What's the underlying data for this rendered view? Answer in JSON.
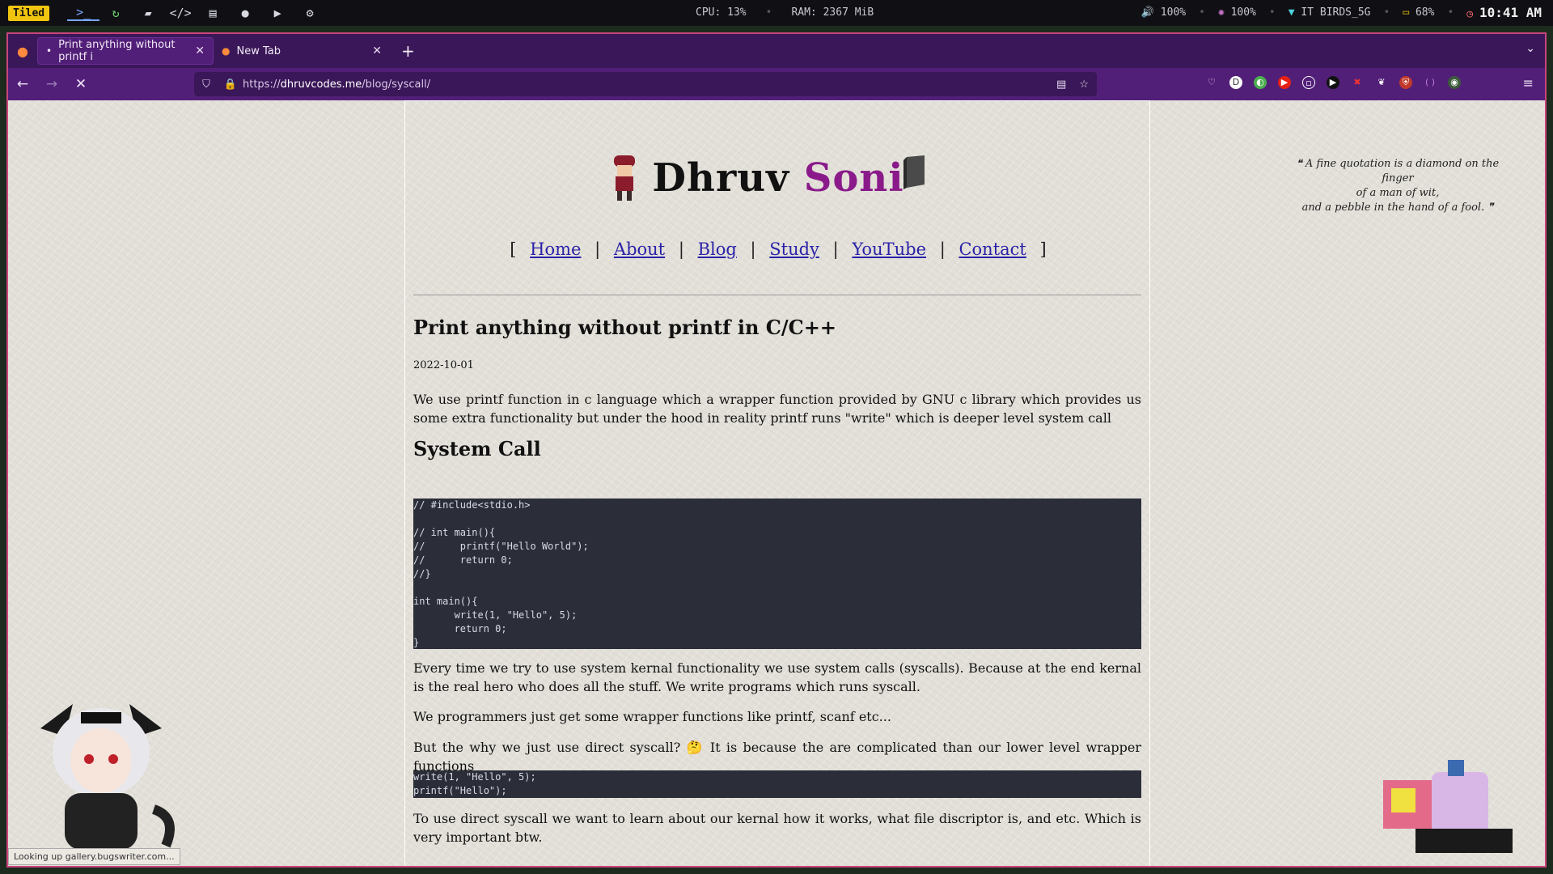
{
  "sysbar": {
    "tiled_label": "Tiled",
    "cpu": "CPU: 13%",
    "ram": "RAM: 2367 MiB",
    "volume": "100%",
    "brightness": "100%",
    "wifi": "IT BIRDS_5G",
    "battery": "68%",
    "clock": "10:41 AM"
  },
  "browser": {
    "tabs": [
      {
        "title": "Print anything without printf i"
      },
      {
        "title": "New Tab"
      }
    ],
    "url": {
      "scheme": "https://",
      "host": "dhruvcodes.me",
      "path": "/blog/syscall/"
    },
    "status_tip": "Looking up gallery.bugswriter.com..."
  },
  "page": {
    "site_title_first": "Dhruv",
    "site_title_last": "Soni",
    "nav": {
      "open": "[",
      "close": "]",
      "sep": "|",
      "home": "Home",
      "about": "About",
      "blog": "Blog",
      "study": "Study",
      "youtube": "YouTube",
      "contact": "Contact"
    },
    "quote_line1": "A fine quotation is a diamond on the finger",
    "quote_line2": "of a man of wit,",
    "quote_line3": "and a pebble in the hand of a fool.",
    "post_title": "Print anything without printf in C/C++",
    "post_date": "2022-10-01",
    "p1": "We use printf function in c language which a wrapper function provided by GNU c library which provides us some extra functionality but under the hood in reality printf runs \"write\" which is deeper level system call",
    "h2": "System Call",
    "code1": "// #include<stdio.h>\n\n// int main(){\n//      printf(\"Hello World\");\n//      return 0;\n//}\n\nint main(){\n       write(1, \"Hello\", 5);\n       return 0;\n}",
    "p2": "Every time we try to use system kernal functionality we use system calls (syscalls). Because at the end kernal is the real hero who does all the stuff. We write programs which runs syscall.",
    "p3": "We programmers just get some wrapper functions like printf, scanf etc...",
    "p4": "But the why we just use direct syscall? 🤔 It is because the are complicated than our lower level wrapper functions",
    "code2": "write(1, \"Hello\", 5);\nprintf(\"Hello\");",
    "p5": "To use direct syscall we want to learn about our kernal how it works, what file discriptor is, and etc. Which is very important btw."
  },
  "colors": {
    "accent": "#c9457c",
    "browser_bg": "#521f78",
    "link": "#2a22a8",
    "title_accent": "#8a1a8a",
    "code_bg": "#2b2e38"
  }
}
